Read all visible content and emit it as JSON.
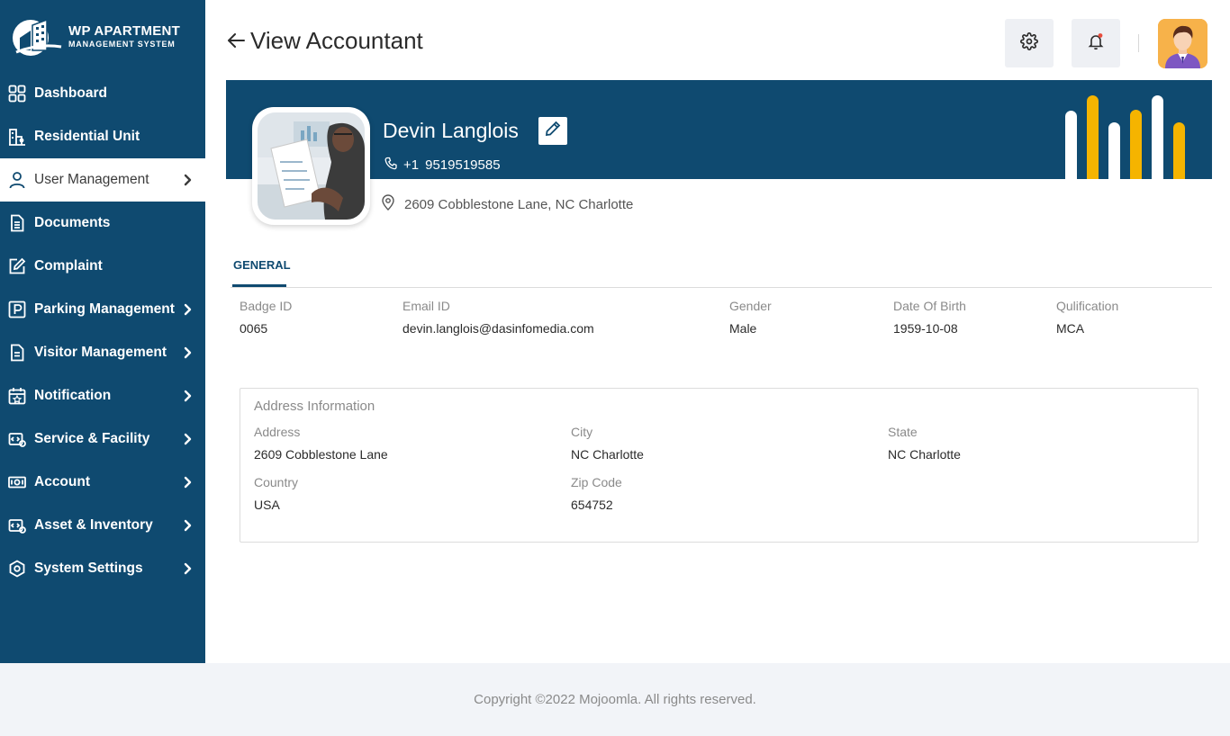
{
  "app": {
    "logo_title": "WP APARTMENT",
    "logo_subtitle": "MANAGEMENT SYSTEM"
  },
  "sidebar": {
    "items": [
      {
        "label": "Dashboard",
        "icon": "dashboard-grid-icon",
        "has_chevron": false,
        "active": false
      },
      {
        "label": "Residential Unit",
        "icon": "building-icon",
        "has_chevron": false,
        "active": false
      },
      {
        "label": "User Management",
        "icon": "user-icon",
        "has_chevron": true,
        "active": true
      },
      {
        "label": "Documents",
        "icon": "document-icon",
        "has_chevron": false,
        "active": false
      },
      {
        "label": "Complaint",
        "icon": "edit-note-icon",
        "has_chevron": false,
        "active": false
      },
      {
        "label": "Parking Management",
        "icon": "parking-icon",
        "has_chevron": true,
        "active": false
      },
      {
        "label": "Visitor Management",
        "icon": "visitor-doc-icon",
        "has_chevron": true,
        "active": false
      },
      {
        "label": "Notification",
        "icon": "calendar-star-icon",
        "has_chevron": true,
        "active": false
      },
      {
        "label": "Service & Facility",
        "icon": "service-icon",
        "has_chevron": true,
        "active": false
      },
      {
        "label": "Account",
        "icon": "money-icon",
        "has_chevron": true,
        "active": false
      },
      {
        "label": "Asset & Inventory",
        "icon": "asset-icon",
        "has_chevron": true,
        "active": false
      },
      {
        "label": "System Settings",
        "icon": "settings-eye-icon",
        "has_chevron": true,
        "active": false
      }
    ]
  },
  "header": {
    "title": "View Accountant",
    "back_icon": "arrow-left-icon",
    "settings_icon": "gear-icon",
    "notification_icon": "bell-icon",
    "notification_dot_color": "#e74c3c"
  },
  "profile": {
    "name": "Devin Langlois",
    "phone_code": "+1",
    "phone": "9519519585",
    "address": "2609 Cobblestone Lane, NC Charlotte"
  },
  "tabs": [
    {
      "label": "GENERAL",
      "active": true
    }
  ],
  "general": {
    "fields": [
      {
        "label": "Badge ID",
        "value": "0065"
      },
      {
        "label": "Email ID",
        "value": "devin.langlois@dasinfomedia.com"
      },
      {
        "label": "Gender",
        "value": "Male"
      },
      {
        "label": "Date Of Birth",
        "value": "1959-10-08"
      },
      {
        "label": "Qulification",
        "value": "MCA"
      }
    ]
  },
  "address_info": {
    "title": "Address Information",
    "fields": [
      {
        "label": "Address",
        "value": "2609 Cobblestone Lane"
      },
      {
        "label": "City",
        "value": "NC Charlotte"
      },
      {
        "label": "State",
        "value": "NC Charlotte"
      },
      {
        "label": "Country",
        "value": "USA"
      },
      {
        "label": "Zip Code",
        "value": "654752"
      }
    ]
  },
  "footer": {
    "text": "Copyright ©2022 Mojoomla. All rights reserved."
  },
  "colors": {
    "primary": "#0f4a70",
    "accent": "#f5b400",
    "footer_bg": "#f2f4f8"
  }
}
